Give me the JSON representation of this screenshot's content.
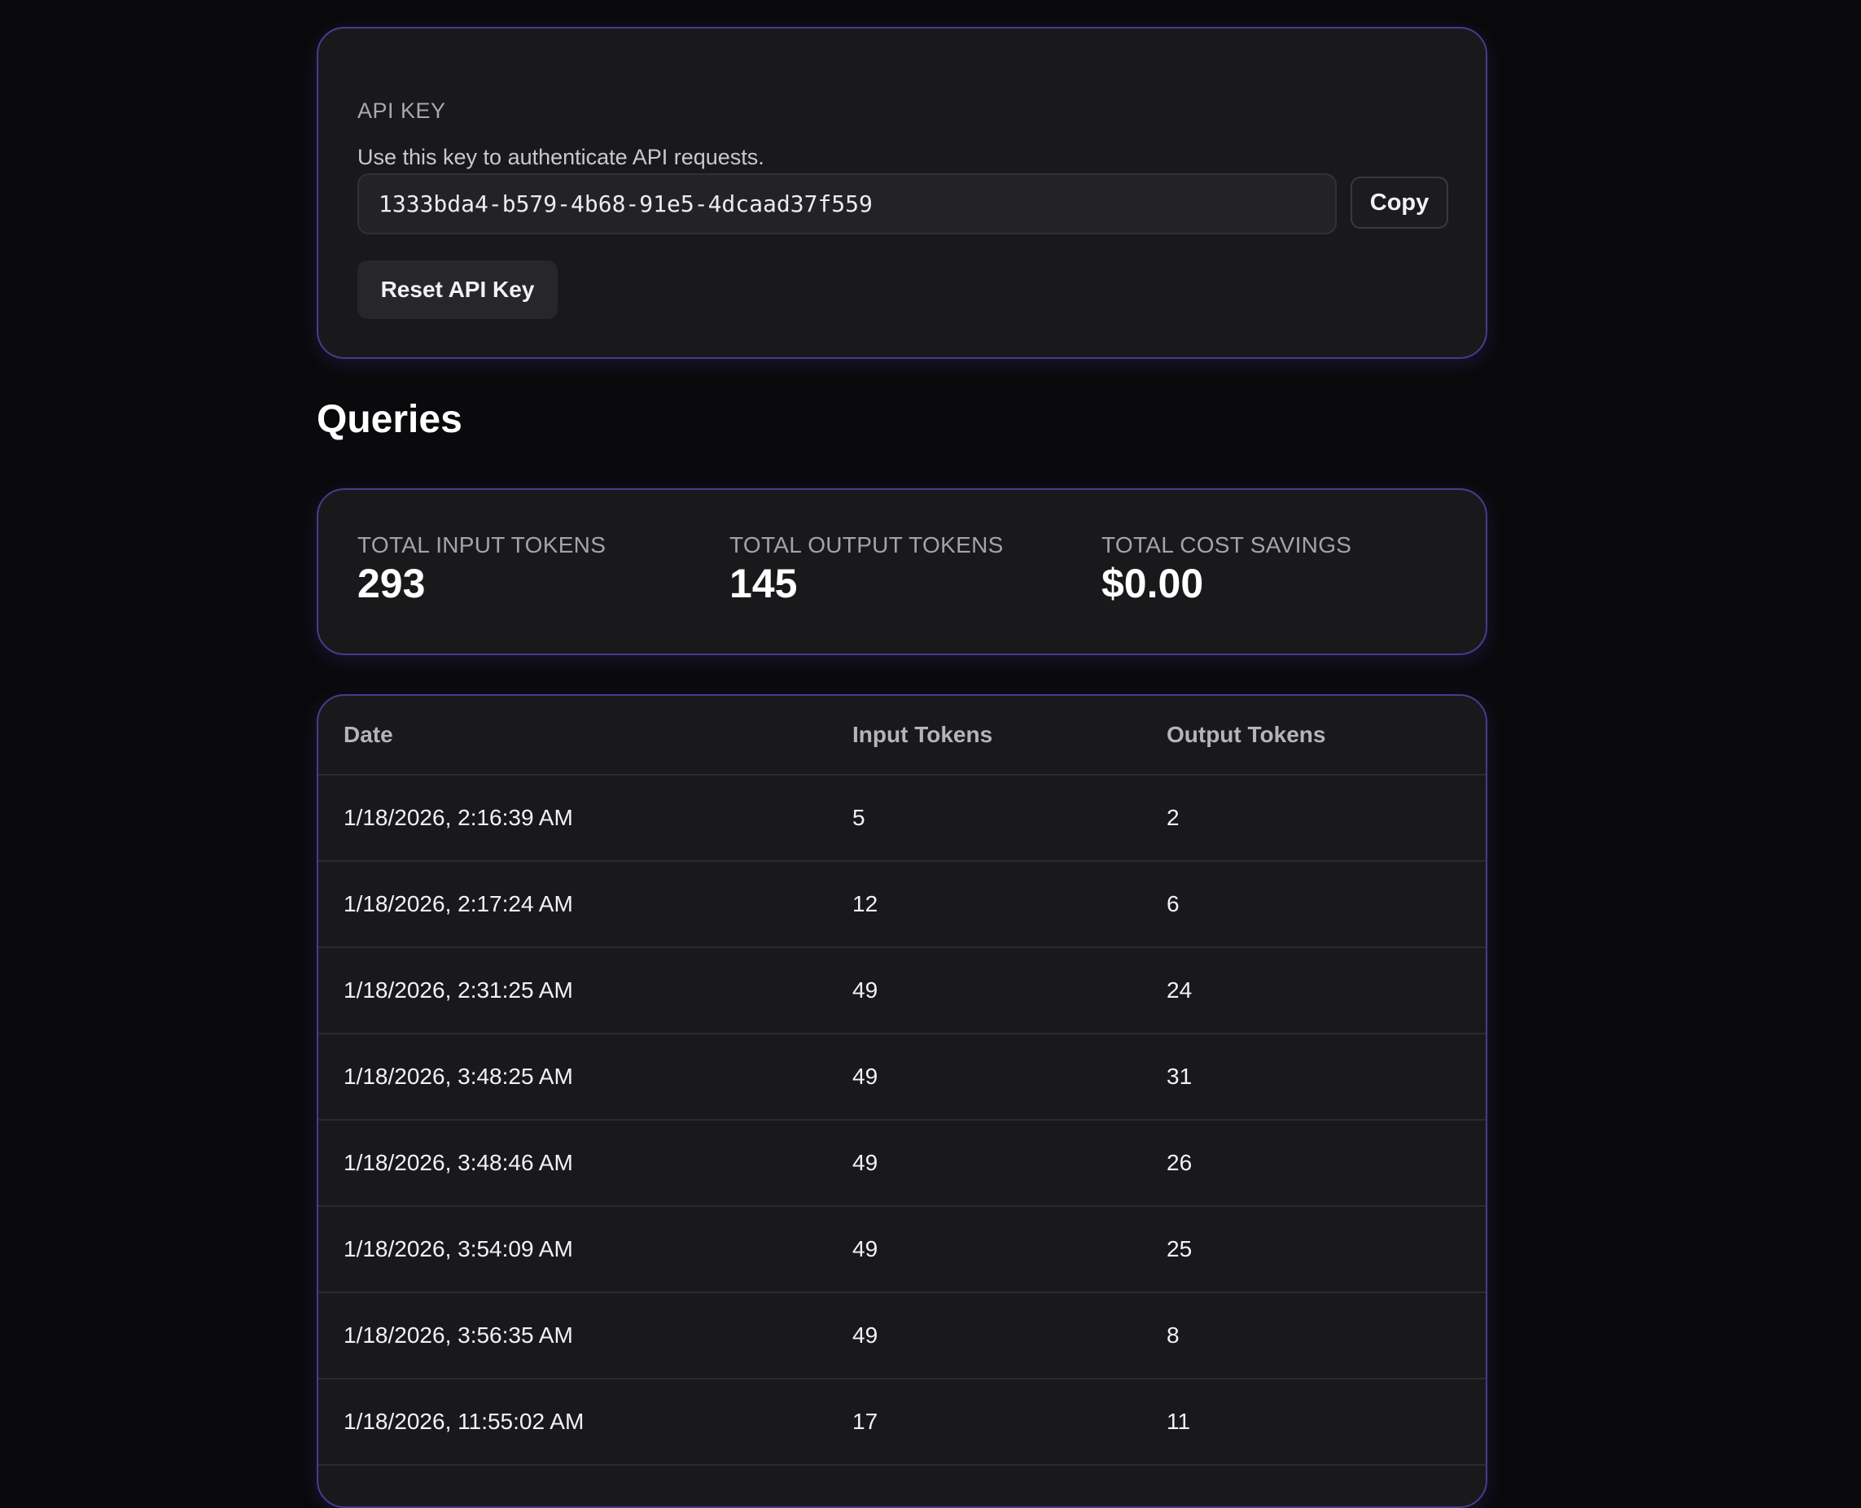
{
  "api_key": {
    "title": "API KEY",
    "description": "Use this key to authenticate API requests.",
    "value": "1333bda4-b579-4b68-91e5-4dcaad37f559",
    "copy_label": "Copy",
    "reset_label": "Reset API Key"
  },
  "queries": {
    "title": "Queries",
    "stats": {
      "input_label": "TOTAL INPUT TOKENS",
      "input_value": "293",
      "output_label": "TOTAL OUTPUT TOKENS",
      "output_value": "145",
      "savings_label": "TOTAL COST SAVINGS",
      "savings_value": "$0.00"
    },
    "table": {
      "headers": [
        "Date",
        "Input Tokens",
        "Output Tokens"
      ],
      "rows": [
        [
          "1/18/2026, 2:16:39 AM",
          "5",
          "2"
        ],
        [
          "1/18/2026, 2:17:24 AM",
          "12",
          "6"
        ],
        [
          "1/18/2026, 2:31:25 AM",
          "49",
          "24"
        ],
        [
          "1/18/2026, 3:48:25 AM",
          "49",
          "31"
        ],
        [
          "1/18/2026, 3:48:46 AM",
          "49",
          "26"
        ],
        [
          "1/18/2026, 3:54:09 AM",
          "49",
          "25"
        ],
        [
          "1/18/2026, 3:56:35 AM",
          "49",
          "8"
        ],
        [
          "1/18/2026, 11:55:02 AM",
          "17",
          "11"
        ]
      ]
    }
  }
}
